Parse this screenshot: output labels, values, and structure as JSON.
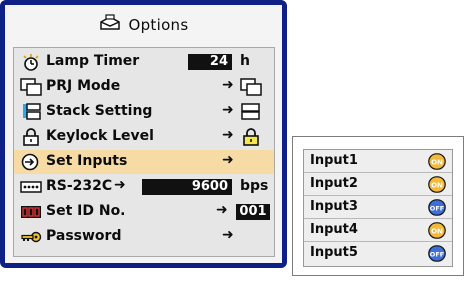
{
  "menu": {
    "title": "Options",
    "items": [
      {
        "label": "Lamp Timer",
        "value": "24",
        "unit": "h",
        "icon": "lamp-timer-icon"
      },
      {
        "label": "PRJ Mode",
        "icon": "prj-mode-icon",
        "value_icon": "prj-mode-icon"
      },
      {
        "label": "Stack Setting",
        "icon": "stack-setting-icon",
        "value_icon": "stack-setting-icon"
      },
      {
        "label": "Keylock Level",
        "icon": "keylock-icon",
        "value_icon": "keylock-icon"
      },
      {
        "label": "Set Inputs",
        "icon": "set-inputs-icon",
        "selected": true
      },
      {
        "label": "RS-232C",
        "value": "9600",
        "unit": "bps",
        "icon": "rs232c-icon"
      },
      {
        "label": "Set ID No.",
        "value": "001",
        "icon": "set-id-icon"
      },
      {
        "label": "Password",
        "icon": "password-key-icon"
      }
    ]
  },
  "submenu": {
    "inputs": [
      {
        "label": "Input1",
        "state": "ON"
      },
      {
        "label": "Input2",
        "state": "ON"
      },
      {
        "label": "Input3",
        "state": "OFF"
      },
      {
        "label": "Input4",
        "state": "ON"
      },
      {
        "label": "Input5",
        "state": "OFF"
      }
    ]
  },
  "colors": {
    "frame": "#0e1f86",
    "selected_row": "#f6dca4",
    "on_badge": "#f2b93a",
    "off_badge": "#3d6fd6"
  }
}
